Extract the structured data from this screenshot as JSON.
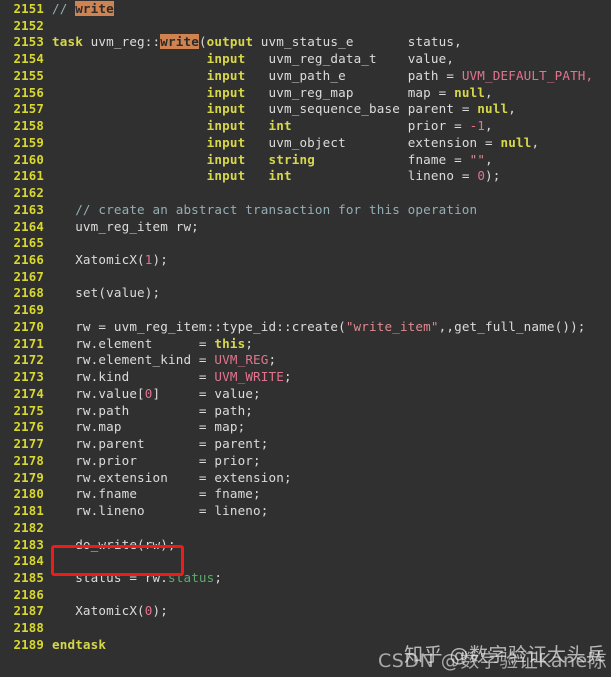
{
  "editor": {
    "background": "#303030",
    "line_number_color": "#d8d82e",
    "highlight_color": "#cf8350",
    "annotation_box_color": "#ee1c19",
    "first_line_number": 2151,
    "last_line_number": 2189
  },
  "lines": [
    {
      "num": "2151",
      "text": "// write"
    },
    {
      "num": "2152",
      "text": ""
    },
    {
      "num": "2153",
      "text": "task uvm_reg::write(output uvm_status_e       status,"
    },
    {
      "num": "2154",
      "text": "                    input   uvm_reg_data_t    value,"
    },
    {
      "num": "2155",
      "text": "                    input   uvm_path_e        path = UVM_DEFAULT_PATH,"
    },
    {
      "num": "2156",
      "text": "                    input   uvm_reg_map       map = null,"
    },
    {
      "num": "2157",
      "text": "                    input   uvm_sequence_base parent = null,"
    },
    {
      "num": "2158",
      "text": "                    input   int               prior = -1,"
    },
    {
      "num": "2159",
      "text": "                    input   uvm_object        extension = null,"
    },
    {
      "num": "2160",
      "text": "                    input   string            fname = \"\","
    },
    {
      "num": "2161",
      "text": "                    input   int               lineno = 0);"
    },
    {
      "num": "2162",
      "text": ""
    },
    {
      "num": "2163",
      "text": "   // create an abstract transaction for this operation"
    },
    {
      "num": "2164",
      "text": "   uvm_reg_item rw;"
    },
    {
      "num": "2165",
      "text": ""
    },
    {
      "num": "2166",
      "text": "   XatomicX(1);"
    },
    {
      "num": "2167",
      "text": ""
    },
    {
      "num": "2168",
      "text": "   set(value);"
    },
    {
      "num": "2169",
      "text": ""
    },
    {
      "num": "2170",
      "text": "   rw = uvm_reg_item::type_id::create(\"write_item\",,get_full_name());"
    },
    {
      "num": "2171",
      "text": "   rw.element      = this;"
    },
    {
      "num": "2172",
      "text": "   rw.element_kind = UVM_REG;"
    },
    {
      "num": "2173",
      "text": "   rw.kind         = UVM_WRITE;"
    },
    {
      "num": "2174",
      "text": "   rw.value[0]     = value;"
    },
    {
      "num": "2175",
      "text": "   rw.path         = path;"
    },
    {
      "num": "2176",
      "text": "   rw.map          = map;"
    },
    {
      "num": "2177",
      "text": "   rw.parent       = parent;"
    },
    {
      "num": "2178",
      "text": "   rw.prior        = prior;"
    },
    {
      "num": "2179",
      "text": "   rw.extension    = extension;"
    },
    {
      "num": "2180",
      "text": "   rw.fname        = fname;"
    },
    {
      "num": "2181",
      "text": "   rw.lineno       = lineno;"
    },
    {
      "num": "2182",
      "text": ""
    },
    {
      "num": "2183",
      "text": "   do_write(rw);"
    },
    {
      "num": "2184",
      "text": ""
    },
    {
      "num": "2185",
      "text": "   status = rw.status;"
    },
    {
      "num": "2186",
      "text": ""
    },
    {
      "num": "2187",
      "text": "   XatomicX(0);"
    },
    {
      "num": "2188",
      "text": ""
    },
    {
      "num": "2189",
      "text": "endtask"
    }
  ],
  "line_numbers": {
    "n2151": "2151",
    "n2152": "2152",
    "n2153": "2153",
    "n2154": "2154",
    "n2155": "2155",
    "n2156": "2156",
    "n2157": "2157",
    "n2158": "2158",
    "n2159": "2159",
    "n2160": "2160",
    "n2161": "2161",
    "n2162": "2162",
    "n2163": "2163",
    "n2164": "2164",
    "n2165": "2165",
    "n2166": "2166",
    "n2167": "2167",
    "n2168": "2168",
    "n2169": "2169",
    "n2170": "2170",
    "n2171": "2171",
    "n2172": "2172",
    "n2173": "2173",
    "n2174": "2174",
    "n2175": "2175",
    "n2176": "2176",
    "n2177": "2177",
    "n2178": "2178",
    "n2179": "2179",
    "n2180": "2180",
    "n2181": "2181",
    "n2182": "2182",
    "n2183": "2183",
    "n2184": "2184",
    "n2185": "2185",
    "n2186": "2186",
    "n2187": "2187",
    "n2188": "2188",
    "n2189": "2189"
  },
  "tokens": {
    "comment_slashes": "// ",
    "search_term": "write",
    "kw_task": "task",
    "scope_uvm_reg": " uvm_reg::",
    "paren_open": "(",
    "kw_output": "output",
    "kw_input": "input",
    "type_uvm_status_e": " uvm_status_e       status,",
    "type_uvm_reg_data_t": "   uvm_reg_data_t    value,",
    "type_uvm_path_e": "   uvm_path_e        path = ",
    "const_uvm_default_path": "UVM_DEFAULT_PATH,",
    "type_uvm_reg_map": "   uvm_reg_map       map = ",
    "kw_null": "null",
    "comma": ",",
    "type_uvm_sequence_base": "   uvm_sequence_base parent = ",
    "kw_int": "int",
    "prior_assign": "               prior = ",
    "num_neg1": "-1",
    "type_uvm_object": "   uvm_object        extension = ",
    "kw_string": "string",
    "fname_assign": "            fname = ",
    "str_empty": "\"\"",
    "lineno_assign": "               lineno = ",
    "num_0": "0",
    "paren_semi": ");",
    "comment_create": "// create an abstract transaction for this operation",
    "decl_rw": "uvm_reg_item rw;",
    "xatomic_open": "XatomicX(",
    "num_1": "1",
    "close_semi": ");",
    "set_value": "set(value);",
    "rw_create_pre": "rw = uvm_reg_item::type_id::create(",
    "str_write_item": "\"write_item\"",
    "rw_create_post": ",,get_full_name());",
    "rw_element": "rw.element      = ",
    "kw_this": "this",
    "semi": ";",
    "rw_element_kind": "rw.element_kind = ",
    "const_uvm_reg": "UVM_REG",
    "rw_kind": "rw.kind         = ",
    "const_uvm_write": "UVM_WRITE",
    "rw_value_pre": "rw.value[",
    "rw_value_post": "]     = value;",
    "rw_path": "rw.path         = path;",
    "rw_map": "rw.map          = map;",
    "rw_parent": "rw.parent       = parent;",
    "rw_prior": "rw.prior        = prior;",
    "rw_extension": "rw.extension    = extension;",
    "rw_fname": "rw.fname        = fname;",
    "rw_lineno": "rw.lineno       = lineno;",
    "do_write_call": "do_write(rw);",
    "status_assign": "status = rw.",
    "member_status": "status",
    "kw_endtask": "endtask"
  },
  "watermarks": {
    "csdn": "CSDN @数字验证Kane陈",
    "zhihu": "知乎 @数字验证大头兵"
  }
}
